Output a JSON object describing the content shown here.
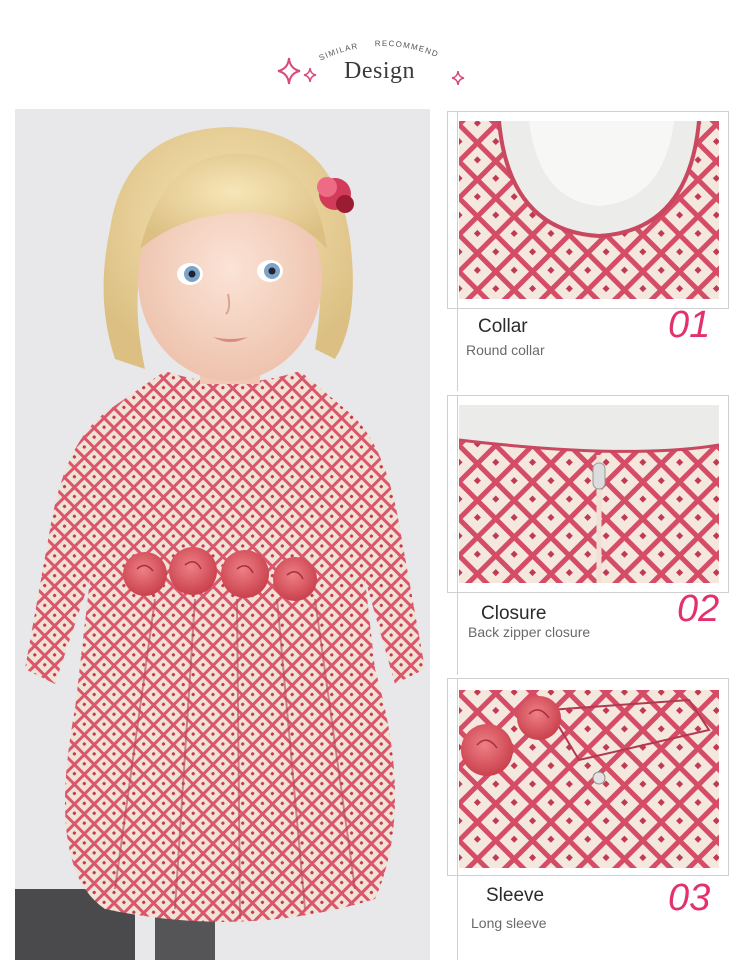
{
  "header": {
    "arc_left": "SIMILAR",
    "arc_right": "RECOMMEND",
    "title": "Design",
    "sparkle_color": "#d94b7a"
  },
  "main_photo": {
    "alt": "girl-in-pink-patterned-dress"
  },
  "details": [
    {
      "title": "Collar",
      "subtitle": "Round collar",
      "number": "01",
      "image": "collar-closeup"
    },
    {
      "title": "Closure",
      "subtitle": "Back zipper closure",
      "number": "02",
      "image": "back-zipper-closeup"
    },
    {
      "title": "Sleeve",
      "subtitle": "Long sleeve",
      "number": "03",
      "image": "sleeve-closeup"
    }
  ],
  "colors": {
    "accent": "#e3306f",
    "fabric_pink": "#d8586f",
    "fabric_cream": "#f3e6dc"
  }
}
